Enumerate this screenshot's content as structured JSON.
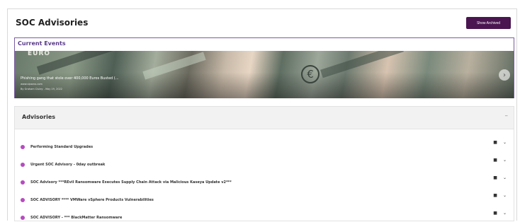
{
  "header": {
    "title": "SOC Advisories",
    "show_archived_label": "Show Archived"
  },
  "current_events": {
    "title": "Current Events",
    "headline": "Phishing gang that stole over 400,000 Euros Busted (...",
    "source": "www.vipsecs.com",
    "byline": "By Graham Cluley - May 19, 2022",
    "image_text": "EURO"
  },
  "advisories": {
    "title": "Advisories",
    "collapse_symbol": "–",
    "items": [
      {
        "label": "Performing Standard Upgrades"
      },
      {
        "label": "Urgent SOC Advisory - 0day outbreak"
      },
      {
        "label": "SOC Advisory ***REvil Ransomware Executes Supply Chain Attack via Malicious Kaseya Update v2***"
      },
      {
        "label": "SOC ADVISORY **** VMWare vSphere Products Vulnerabilities"
      },
      {
        "label": "SOC ADVISORY - *** BlackMatter Ransomware"
      }
    ]
  },
  "icons": {
    "document": "document-icon",
    "expand": "chevron-down-icon",
    "next": "chevron-right-icon",
    "status": "status-dot-icon"
  },
  "colors": {
    "brand": "#4a1550",
    "accent": "#b64bc0"
  }
}
